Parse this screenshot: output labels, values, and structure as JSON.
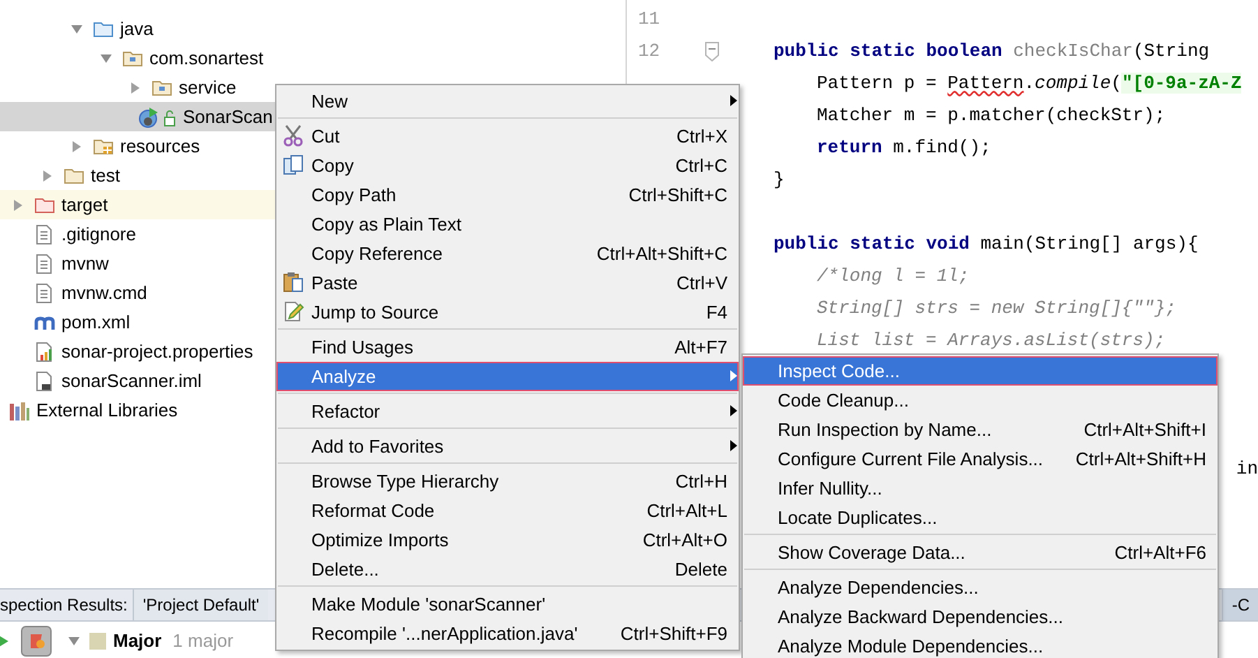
{
  "project_tree": {
    "nodes": [
      {
        "children": [
          {
            "children": [
              {
                "children": [
                  {
                    "label": "java",
                    "kind": "source-folder",
                    "expanded": true,
                    "selected": false,
                    "children": [
                      {
                        "label": "com.sonartest",
                        "kind": "package",
                        "expanded": true,
                        "selected": false,
                        "children": [
                          {
                            "label": "service",
                            "kind": "package",
                            "expanded": false,
                            "selected": false
                          },
                          {
                            "label": "SonarScan",
                            "kind": "java-class",
                            "selected": true
                          }
                        ]
                      }
                    ]
                  },
                  {
                    "label": "resources",
                    "kind": "resources-folder",
                    "expanded": false,
                    "selected": false
                  }
                ]
              },
              {
                "label": "test",
                "kind": "folder",
                "expanded": false,
                "selected": false
              }
            ]
          },
          {
            "label": "target",
            "kind": "excluded-folder",
            "expanded": false,
            "selected": false,
            "color": "#fcfae6"
          },
          {
            "label": ".gitignore",
            "kind": "text-file",
            "selected": false
          },
          {
            "label": "mvnw",
            "kind": "text-file",
            "selected": false
          },
          {
            "label": "mvnw.cmd",
            "kind": "text-file",
            "selected": false
          },
          {
            "label": "pom.xml",
            "kind": "maven-file",
            "selected": false
          },
          {
            "label": "sonar-project.properties",
            "kind": "properties-file",
            "selected": false
          },
          {
            "label": "sonarScanner.iml",
            "kind": "module-file",
            "selected": false
          }
        ]
      },
      {
        "label": "External Libraries",
        "kind": "libraries",
        "selected": false
      }
    ]
  },
  "editor": {
    "lines": [
      {
        "kind": "blank",
        "number": "11"
      },
      {
        "kind": "code",
        "number": "12",
        "fold": true,
        "segments": [
          {
            "kind": "keyword",
            "text": "public static boolean"
          },
          {
            "kind": "unused",
            "text": " checkIsChar"
          },
          {
            "kind": "plain",
            "text": "(String"
          }
        ]
      },
      {
        "kind": "code",
        "indented": true,
        "segments": [
          {
            "kind": "plain",
            "text": "Pattern p = "
          },
          {
            "kind": "error",
            "text": "Pattern"
          },
          {
            "kind": "plain",
            "text": "."
          },
          {
            "kind": "italic",
            "text": "compile"
          },
          {
            "kind": "plain",
            "text": "("
          },
          {
            "kind": "string",
            "text": "\"[0-9a-zA-Z"
          }
        ]
      },
      {
        "kind": "code",
        "indented": true,
        "segments": [
          {
            "kind": "plain",
            "text": "Matcher m = p.matcher(checkStr);"
          }
        ]
      },
      {
        "kind": "code",
        "indented": true,
        "segments": [
          {
            "kind": "keyword",
            "text": "return"
          },
          {
            "kind": "plain",
            "text": " m.find();"
          }
        ]
      },
      {
        "kind": "code",
        "segments": [
          {
            "kind": "plain",
            "text": "}"
          }
        ]
      },
      {
        "kind": "blank"
      },
      {
        "kind": "code",
        "segments": [
          {
            "kind": "keyword",
            "text": "public static void"
          },
          {
            "kind": "plain",
            "text": " main(String[] args){"
          }
        ]
      },
      {
        "kind": "code",
        "indented": true,
        "segments": [
          {
            "kind": "comment",
            "text": "/*long l = 1l;"
          }
        ]
      },
      {
        "kind": "code",
        "indented": true,
        "segments": [
          {
            "kind": "comment",
            "text": "String[] strs = new String[]{\"\"};"
          }
        ]
      },
      {
        "kind": "code",
        "indented": true,
        "segments": [
          {
            "kind": "comment",
            "text": "List list = Arrays.asList(strs);"
          }
        ]
      },
      {
        "kind": "blank"
      },
      {
        "kind": "blank"
      },
      {
        "kind": "blank"
      },
      {
        "kind": "fragment",
        "segments": [
          {
            "kind": "plain",
            "text": "in"
          }
        ]
      }
    ]
  },
  "context_menu": {
    "groups": [
      [
        {
          "label": "New",
          "submenu": true,
          "selected": false
        }
      ],
      [
        {
          "label": "Cut",
          "shortcut": "Ctrl+X",
          "submenu": false,
          "selected": false
        },
        {
          "label": "Copy",
          "shortcut": "Ctrl+C",
          "submenu": false,
          "selected": false
        },
        {
          "label": "Copy Path",
          "shortcut": "Ctrl+Shift+C",
          "submenu": false,
          "selected": false
        },
        {
          "label": "Copy as Plain Text",
          "submenu": false,
          "selected": false
        },
        {
          "label": "Copy Reference",
          "shortcut": "Ctrl+Alt+Shift+C",
          "submenu": false,
          "selected": false
        },
        {
          "label": "Paste",
          "shortcut": "Ctrl+V",
          "submenu": false,
          "selected": false
        },
        {
          "label": "Jump to Source",
          "shortcut": "F4",
          "submenu": false,
          "selected": false
        }
      ],
      [
        {
          "label": "Find Usages",
          "shortcut": "Alt+F7",
          "submenu": false,
          "selected": false
        },
        {
          "label": "Analyze",
          "submenu": true,
          "selected": true
        }
      ],
      [
        {
          "label": "Refactor",
          "submenu": true,
          "selected": false
        }
      ],
      [
        {
          "label": "Add to Favorites",
          "submenu": true,
          "selected": false
        }
      ],
      [
        {
          "label": "Browse Type Hierarchy",
          "shortcut": "Ctrl+H",
          "submenu": false,
          "selected": false
        },
        {
          "label": "Reformat Code",
          "shortcut": "Ctrl+Alt+L",
          "submenu": false,
          "selected": false
        },
        {
          "label": "Optimize Imports",
          "shortcut": "Ctrl+Alt+O",
          "submenu": false,
          "selected": false
        },
        {
          "label": "Delete...",
          "shortcut": "Delete",
          "submenu": false,
          "selected": false
        }
      ],
      [
        {
          "label": "Make Module 'sonarScanner'",
          "submenu": false,
          "selected": false
        },
        {
          "label": "Recompile '...nerApplication.java'",
          "shortcut": "Ctrl+Shift+F9",
          "submenu": false,
          "selected": false
        }
      ]
    ]
  },
  "analyze_submenu": {
    "groups": [
      [
        {
          "label": "Inspect Code...",
          "submenu": false,
          "selected": true
        },
        {
          "label": "Code Cleanup...",
          "submenu": false,
          "selected": false
        },
        {
          "label": "Run Inspection by Name...",
          "shortcut": "Ctrl+Alt+Shift+I",
          "submenu": false,
          "selected": false
        },
        {
          "label": "Configure Current File Analysis...",
          "shortcut": "Ctrl+Alt+Shift+H",
          "submenu": false,
          "selected": false
        },
        {
          "label": "Infer Nullity...",
          "submenu": false,
          "selected": false
        },
        {
          "label": "Locate Duplicates...",
          "submenu": false,
          "selected": false
        }
      ],
      [
        {
          "label": "Show Coverage Data...",
          "shortcut": "Ctrl+Alt+F6",
          "submenu": false,
          "selected": false
        }
      ],
      [
        {
          "label": "Analyze Dependencies...",
          "submenu": false,
          "selected": false
        },
        {
          "label": "Analyze Backward Dependencies...",
          "submenu": false,
          "selected": false
        },
        {
          "label": "Analyze Module Dependencies...",
          "submenu": false,
          "selected": false
        }
      ]
    ]
  },
  "inspection_panel": {
    "title": "spection Results:",
    "tabs": [
      {
        "label": "'Project Default'",
        "selected": false
      }
    ],
    "trailing_tab": {
      "label": "-C",
      "selected": false
    },
    "group": {
      "label": "Major",
      "count": "1 major",
      "expanded": true
    }
  }
}
